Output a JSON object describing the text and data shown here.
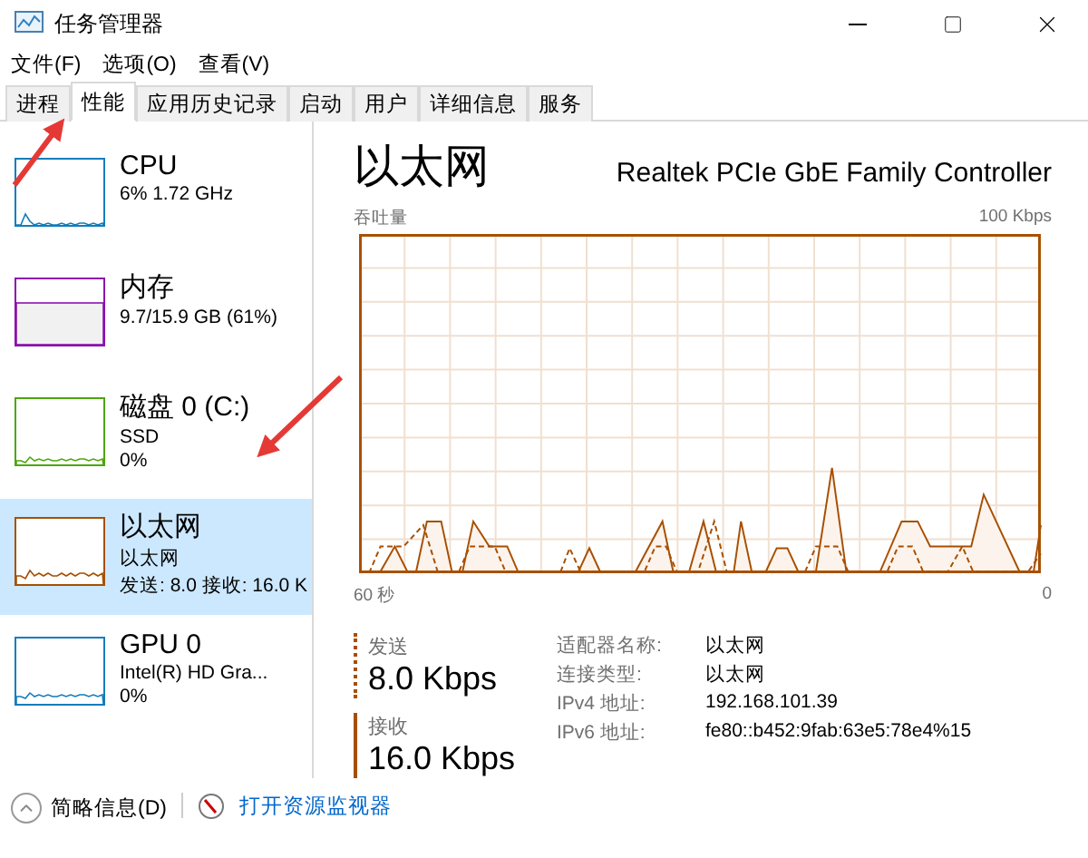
{
  "window": {
    "title": "任务管理器"
  },
  "menu": [
    "文件(F)",
    "选项(O)",
    "查看(V)"
  ],
  "tabs": [
    {
      "label": "进程",
      "selected": false
    },
    {
      "label": "性能",
      "selected": true
    },
    {
      "label": "应用历史记录",
      "selected": false
    },
    {
      "label": "启动",
      "selected": false
    },
    {
      "label": "用户",
      "selected": false
    },
    {
      "label": "详细信息",
      "selected": false
    },
    {
      "label": "服务",
      "selected": false
    }
  ],
  "sidebar": {
    "items": [
      {
        "kind": "graph",
        "title": "CPU",
        "lines": [
          "6% 1.72 GHz"
        ],
        "color": "#117dbb",
        "selected": false
      },
      {
        "kind": "usage",
        "title": "内存",
        "lines": [
          "9.7/15.9 GB (61%)"
        ],
        "color": "#8b12ae",
        "selected": false
      },
      {
        "kind": "graph",
        "title": "磁盘 0 (C:)",
        "lines": [
          "SSD",
          "0%"
        ],
        "color": "#4da60c",
        "selected": false
      },
      {
        "kind": "graph",
        "title": "以太网",
        "lines": [
          "以太网",
          "发送: 8.0 接收: 16.0 K"
        ],
        "color": "#a74f01",
        "selected": true
      },
      {
        "kind": "graph",
        "title": "GPU 0",
        "lines": [
          "Intel(R) HD Gra...",
          "0%"
        ],
        "color": "#117dbb",
        "selected": false
      }
    ]
  },
  "detail": {
    "title": "以太网",
    "adapter": "Realtek PCIe GbE Family Controller",
    "graph_label": "吞吐量",
    "graph_max": "100 Kbps",
    "graph_span": "60 秒",
    "graph_min": "0",
    "stats": [
      {
        "kind": "send",
        "label": "发送",
        "value": "8.0 Kbps"
      },
      {
        "kind": "receive",
        "label": "接收",
        "value": "16.0 Kbps"
      }
    ],
    "properties": [
      {
        "label": "适配器名称:",
        "value": "以太网"
      },
      {
        "label": "连接类型:",
        "value": "以太网"
      },
      {
        "label": "IPv4 地址:",
        "value": "192.168.101.39"
      },
      {
        "label": "IPv6 地址:",
        "value": "fe80::b452:9fab:63e5:78e4%15"
      }
    ]
  },
  "footer": {
    "fewer_details": "简略信息(D)",
    "resource_monitor": "打开资源监视器"
  }
}
